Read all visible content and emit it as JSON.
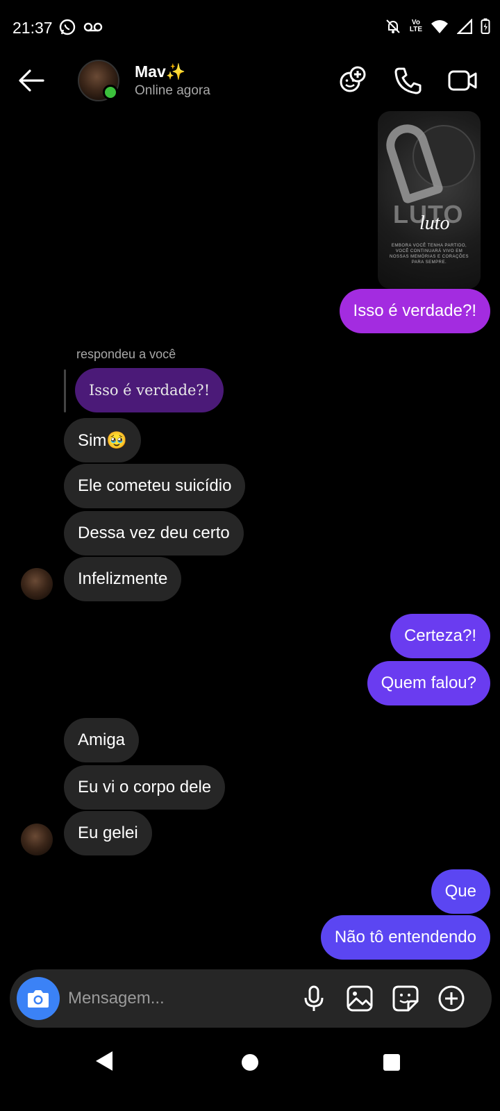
{
  "status_bar": {
    "time": "21:37",
    "volte_line1": "Vo",
    "volte_line2": "LTE",
    "icons": [
      "whatsapp-icon",
      "voicemail-icon",
      "bell-off-icon",
      "volte-icon",
      "wifi-icon",
      "signal-icon",
      "battery-icon"
    ]
  },
  "header": {
    "name": "Mav✨",
    "status": "Online agora",
    "icons": [
      "back-arrow-icon",
      "add-people-icon",
      "phone-icon",
      "video-icon"
    ]
  },
  "shared_image": {
    "title_big": "LUTO",
    "title_script": "luto",
    "caption": "EMBORA VOCÊ TENHA PARTIDO, VOCÊ CONTINUARÁ VIVO EM NOSSAS MEMÓRIAS E CORAÇÕES PARA SEMPRE."
  },
  "messages": {
    "out_1": "Isso é verdade?!",
    "reply_label": "respondeu a você",
    "reply_quote": "Isso é verdade?!",
    "in_1": "Sim🥹",
    "in_2": "Ele cometeu suicídio",
    "in_3": "Dessa vez deu certo",
    "in_4": "Infelizmente",
    "out_2": "Certeza?!",
    "out_3": "Quem falou?",
    "in_5": "Amiga",
    "in_6": "Eu vi o corpo dele",
    "in_7": "Eu gelei",
    "out_4": "Que",
    "out_5": "Não tô entendendo"
  },
  "composer": {
    "placeholder": "Mensagem...",
    "icons": [
      "camera-icon",
      "microphone-icon",
      "gallery-icon",
      "sticker-icon",
      "plus-circle-icon"
    ]
  },
  "colors": {
    "accent_blue": "#3b82f6",
    "bubble_in": "#262626",
    "bubble_out_pink": "#a32ce0",
    "bubble_out_violet": "#6a3cf0",
    "online": "#3cc13c"
  }
}
